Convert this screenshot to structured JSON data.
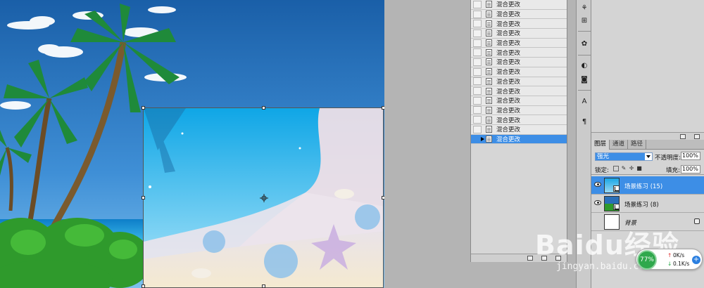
{
  "history": {
    "step_label": "混合更改",
    "steps": [
      "混合更改",
      "混合更改",
      "混合更改",
      "混合更改",
      "混合更改",
      "混合更改",
      "混合更改",
      "混合更改",
      "混合更改",
      "混合更改",
      "混合更改",
      "混合更改",
      "混合更改",
      "混合更改",
      "混合更改"
    ],
    "active_index": 14
  },
  "layers_panel": {
    "tabs": [
      "图层",
      "通道",
      "路径"
    ],
    "active_tab": 0,
    "blend_mode": "强光",
    "opacity_label": "不透明度:",
    "opacity_value": "100%",
    "lock_label": "锁定:",
    "fill_label": "填充:",
    "fill_value": "100%",
    "layers": [
      {
        "name": "场景练习 (15)",
        "active": true
      },
      {
        "name": "场景练习 (8)",
        "active": false
      },
      {
        "name": "背景",
        "active": false
      }
    ]
  },
  "watermark": {
    "brand": "Baidu经验",
    "url": "jingyan.baidu.com"
  },
  "net_widget": {
    "percent": "77%",
    "upload": "0K/s",
    "download": "0.1K/s"
  },
  "colors": {
    "selection": "#3d8ee6",
    "panel": "#d4d4d4",
    "workspace": "#b4b4b4"
  }
}
